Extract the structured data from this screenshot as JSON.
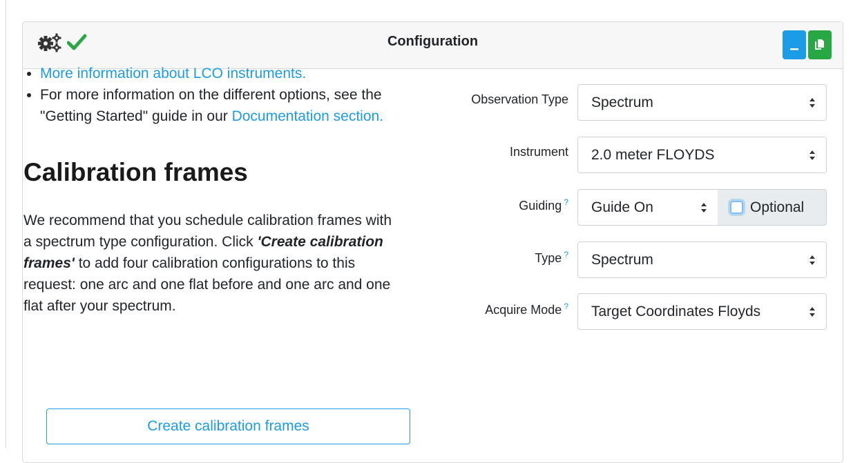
{
  "header": {
    "title": "Configuration",
    "icons": [
      "gears-icon",
      "check-icon"
    ],
    "buttons": [
      {
        "name": "minimize-button",
        "symbol": "_",
        "color": "#1c9be6"
      },
      {
        "name": "copy-button",
        "symbol": "copy-icon",
        "color": "#28a745"
      }
    ]
  },
  "info": {
    "item1_link": "More information about LCO instruments.",
    "item2_text": "For more information on the different options, see the \"Getting Started\" guide in our ",
    "item2_link": "Documentation section."
  },
  "calibration": {
    "heading": "Calibration frames",
    "desc_part1": "We recommend that you schedule calibration frames with a spectrum type configuration. Click ",
    "desc_emph": "'Create calibration frames'",
    "desc_part2": " to add four calibration configurations to this request: one arc and one flat before and one arc and one flat after your spectrum.",
    "button_label": "Create calibration frames"
  },
  "form": {
    "observation_type": {
      "label": "Observation Type",
      "value": "Spectrum"
    },
    "instrument": {
      "label": "Instrument",
      "value": "2.0 meter FLOYDS"
    },
    "guiding": {
      "label": "Guiding",
      "help": "?",
      "value": "Guide On",
      "optional_label": "Optional",
      "optional_checked": false
    },
    "type": {
      "label": "Type",
      "help": "?",
      "value": "Spectrum"
    },
    "acquire_mode": {
      "label": "Acquire Mode",
      "help": "?",
      "value": "Target Coordinates Floyds"
    }
  },
  "colors": {
    "accent": "#1c9be6",
    "success": "#28a745"
  }
}
